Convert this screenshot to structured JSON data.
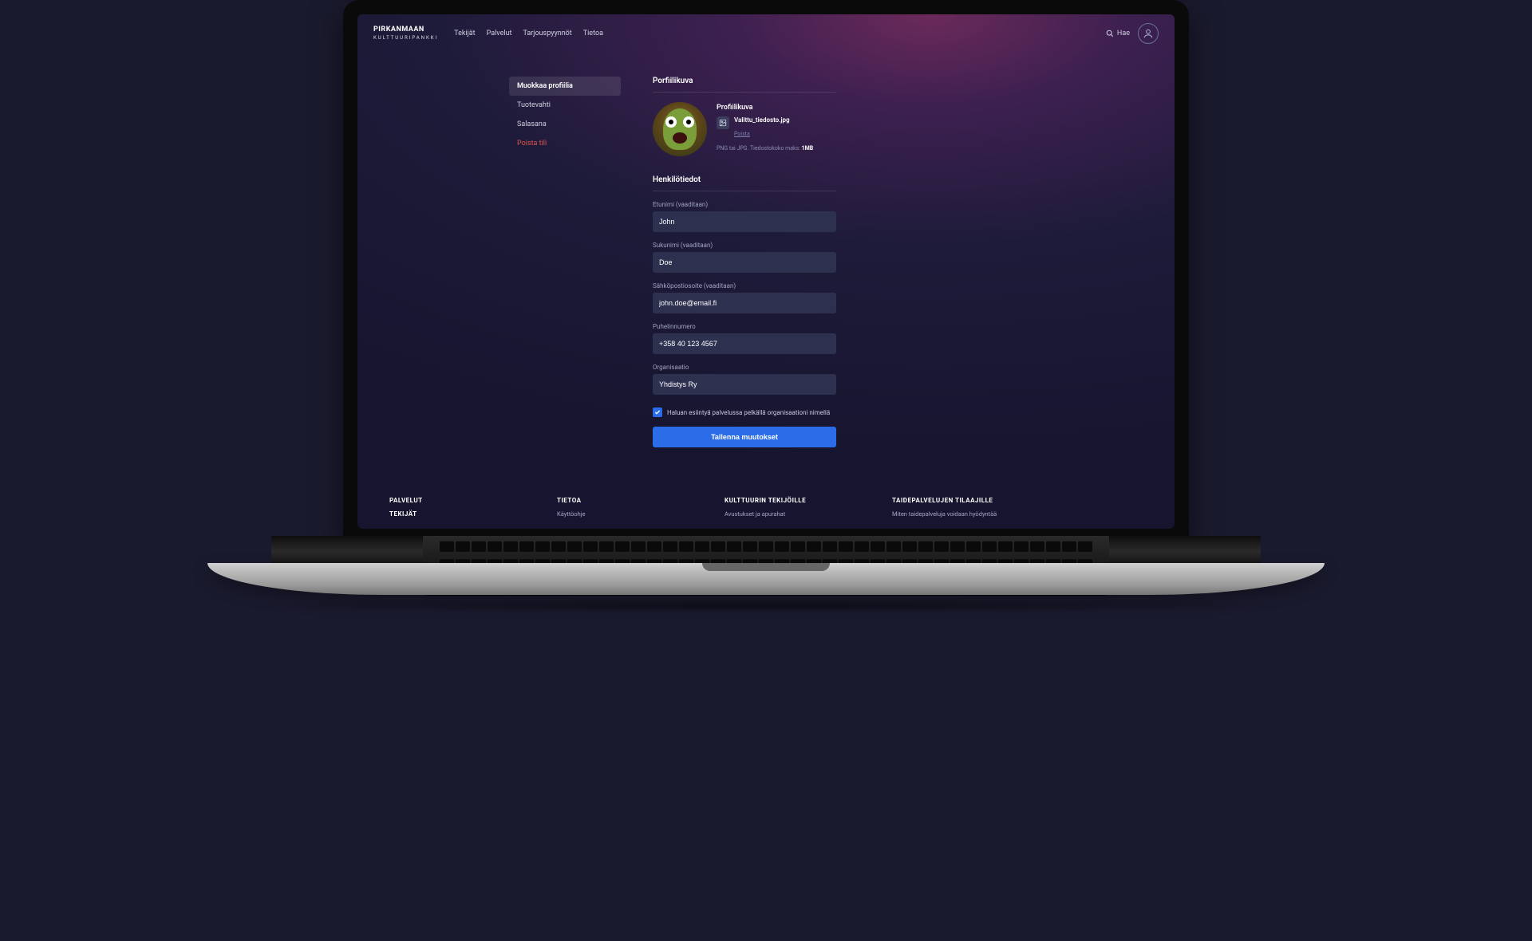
{
  "brand": {
    "line1": "PIRKANMAAN",
    "line2": "KULTTUURIPANKKI"
  },
  "nav": {
    "tekijat": "Tekijät",
    "palvelut": "Palvelut",
    "tarjouspyynnot": "Tarjouspyynnöt",
    "tietoa": "Tietoa",
    "hae": "Hae"
  },
  "sidenav": {
    "muokkaa": "Muokkaa profiilia",
    "tuotevahti": "Tuotevahti",
    "salasana": "Salasana",
    "poista": "Poista tili"
  },
  "profilePic": {
    "section": "Porfiilikuva",
    "label": "Profiilikuva",
    "filename": "Valittu_tiedosto.jpg",
    "delete": "Poista",
    "hint_prefix": "PNG tai JPG. Tiedostokoko maks: ",
    "hint_max": "1MB"
  },
  "personal": {
    "section": "Henkilötiedot",
    "firstname_label": "Etunimi (vaaditaan)",
    "firstname": "John",
    "lastname_label": "Sukunimi (vaaditaan)",
    "lastname": "Doe",
    "email_label": "Sähköpostiosoite (vaaditaan)",
    "email": "john.doe@email.fi",
    "phone_label": "Puhelinnumero",
    "phone": "+358 40 123 4567",
    "org_label": "Organisaatio",
    "org": "Yhdistys Ry",
    "checkbox_label": "Haluan esiintyä palvelussa pelkällä organisaationi nimellä",
    "submit": "Tallenna muutokset"
  },
  "footer": {
    "col1": {
      "h1": "PALVELUT",
      "h2": "TEKIJÄT"
    },
    "col2": {
      "h": "TIETOA",
      "a1": "Käyttöohje"
    },
    "col3": {
      "h": "KULTTUURIN TEKIJÖILLE",
      "a1": "Avustukset ja apurahat"
    },
    "col4": {
      "h": "TAIDEPALVELUJEN TILAAJILLE",
      "a1": "Miten taidepalveluja voidaan hyödyntää"
    }
  }
}
